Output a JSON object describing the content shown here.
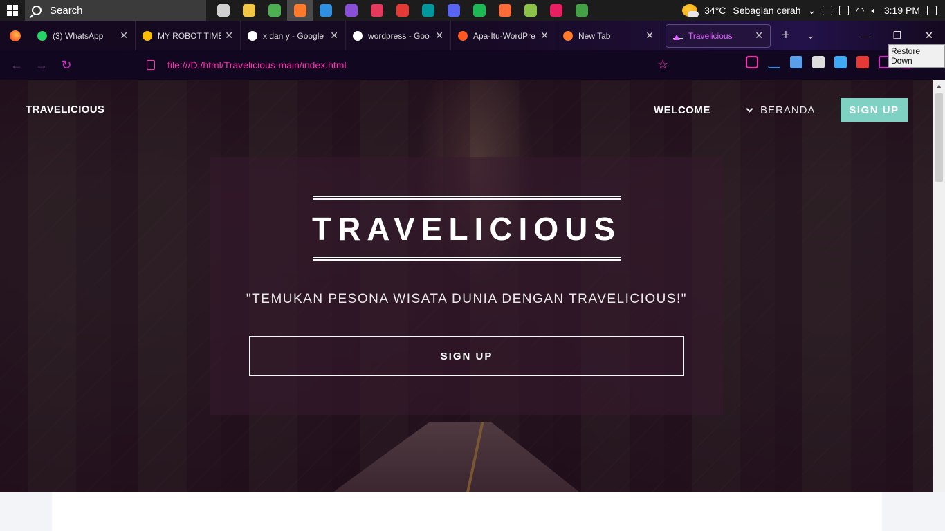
{
  "taskbar": {
    "search_placeholder": "Search",
    "weather": {
      "temp": "34°C",
      "condition": "Sebagian cerah"
    },
    "time": "3:19 PM",
    "apps": [
      {
        "name": "task-view-icon",
        "color": "#d0d0d0"
      },
      {
        "name": "file-explorer-icon",
        "color": "#f2c744"
      },
      {
        "name": "chrome-icon",
        "color": "#4caf50"
      },
      {
        "name": "firefox-icon",
        "color": "#ff7a2b"
      },
      {
        "name": "vscode-icon",
        "color": "#2f8fe0"
      },
      {
        "name": "github-desktop-icon",
        "color": "#8a4fd8"
      },
      {
        "name": "app-m-icon",
        "color": "#e43a5c"
      },
      {
        "name": "app-f-icon",
        "color": "#e53935"
      },
      {
        "name": "arduino-icon",
        "color": "#00979d"
      },
      {
        "name": "discord-icon",
        "color": "#5865f2"
      },
      {
        "name": "spotify-icon",
        "color": "#1db954"
      },
      {
        "name": "postman-icon",
        "color": "#ff6c37"
      },
      {
        "name": "app-grid-icon",
        "color": "#8bc34a"
      },
      {
        "name": "app-grid2-icon",
        "color": "#e91e63"
      },
      {
        "name": "chrome-dev-icon",
        "color": "#43a047"
      }
    ]
  },
  "tabs": [
    {
      "title": "(3) WhatsApp",
      "fav": "#25d366",
      "icon": "whatsapp-icon"
    },
    {
      "title": "MY ROBOT TIME -",
      "fav": "#fbbc04",
      "icon": "google-drive-icon"
    },
    {
      "title": "x dan y - Google F",
      "fav": "#ffffff",
      "icon": "google-icon"
    },
    {
      "title": "wordpress - Goo",
      "fav": "#ffffff",
      "icon": "google-icon"
    },
    {
      "title": "Apa-Itu-WordPre",
      "fav": "#ff5722",
      "icon": "slides-icon"
    },
    {
      "title": "New Tab",
      "fav": "#ff7a2b",
      "icon": "firefox-icon"
    }
  ],
  "active_tab": {
    "title": "Travelicious"
  },
  "tooltip": "Restore Down",
  "address": {
    "url": "file:///D:/html/Travelicious-main/index.html"
  },
  "site": {
    "brand": "TRAVELICIOUS",
    "nav_welcome": "WELCOME",
    "nav_beranda": "BERANDA",
    "nav_signup": "SIGN UP",
    "hero_title": "TRAVELICIOUS",
    "hero_tagline": "\"TEMUKAN PESONA WISATA DUNIA DENGAN TRAVELICIOUS!\"",
    "hero_button": "SIGN UP"
  },
  "colors": {
    "accent": "#7fd1c3",
    "browser_accent": "#ff2fb3"
  }
}
